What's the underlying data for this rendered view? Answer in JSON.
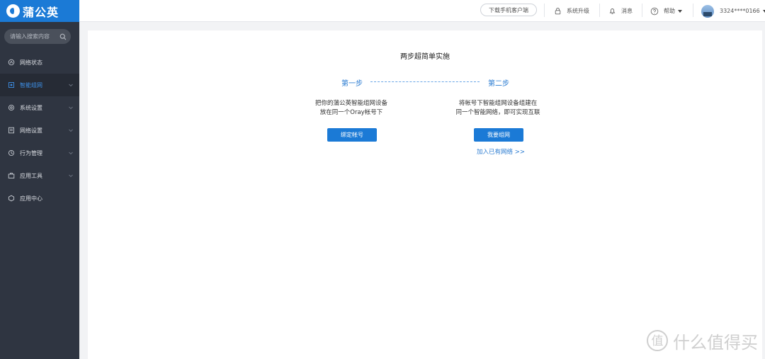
{
  "brand": {
    "name": "蒲公英",
    "color": "#1b7ad6"
  },
  "sidebar": {
    "search_placeholder": "请输入搜索内容",
    "items": [
      {
        "label": "网络状态",
        "icon": "network-status-icon",
        "has_submenu": false,
        "active": false
      },
      {
        "label": "智能组网",
        "icon": "smart-networking-icon",
        "has_submenu": true,
        "active": true
      },
      {
        "label": "系统设置",
        "icon": "system-settings-icon",
        "has_submenu": true,
        "active": false
      },
      {
        "label": "网络设置",
        "icon": "network-settings-icon",
        "has_submenu": true,
        "active": false
      },
      {
        "label": "行为管理",
        "icon": "behavior-management-icon",
        "has_submenu": true,
        "active": false
      },
      {
        "label": "应用工具",
        "icon": "app-tools-icon",
        "has_submenu": true,
        "active": false
      },
      {
        "label": "应用中心",
        "icon": "app-center-icon",
        "has_submenu": false,
        "active": false
      }
    ]
  },
  "topbar": {
    "download_label": "下载手机客户端",
    "upgrade_label": "系统升级",
    "messages_label": "消息",
    "help_label": "帮助",
    "account": "3324****0166"
  },
  "main": {
    "title": "两步超简单实施",
    "step1": {
      "label": "第一步",
      "desc_line1": "把你的蒲公英智能组网设备",
      "desc_line2": "放在同一个Oray帐号下",
      "button": "绑定帐号"
    },
    "step2": {
      "label": "第二步",
      "desc_line1": "将帐号下智能组网设备组建在",
      "desc_line2": "同一个智能网络，即可实现互联",
      "button": "我要组网",
      "link": "加入已有网络 >>"
    }
  },
  "watermark": {
    "text": "什么值得买",
    "icon": "zhide-logo-icon"
  },
  "colors": {
    "accent": "#1b7ad6",
    "sidebar_bg": "#2f3541",
    "active_text": "#3d8fe6"
  }
}
